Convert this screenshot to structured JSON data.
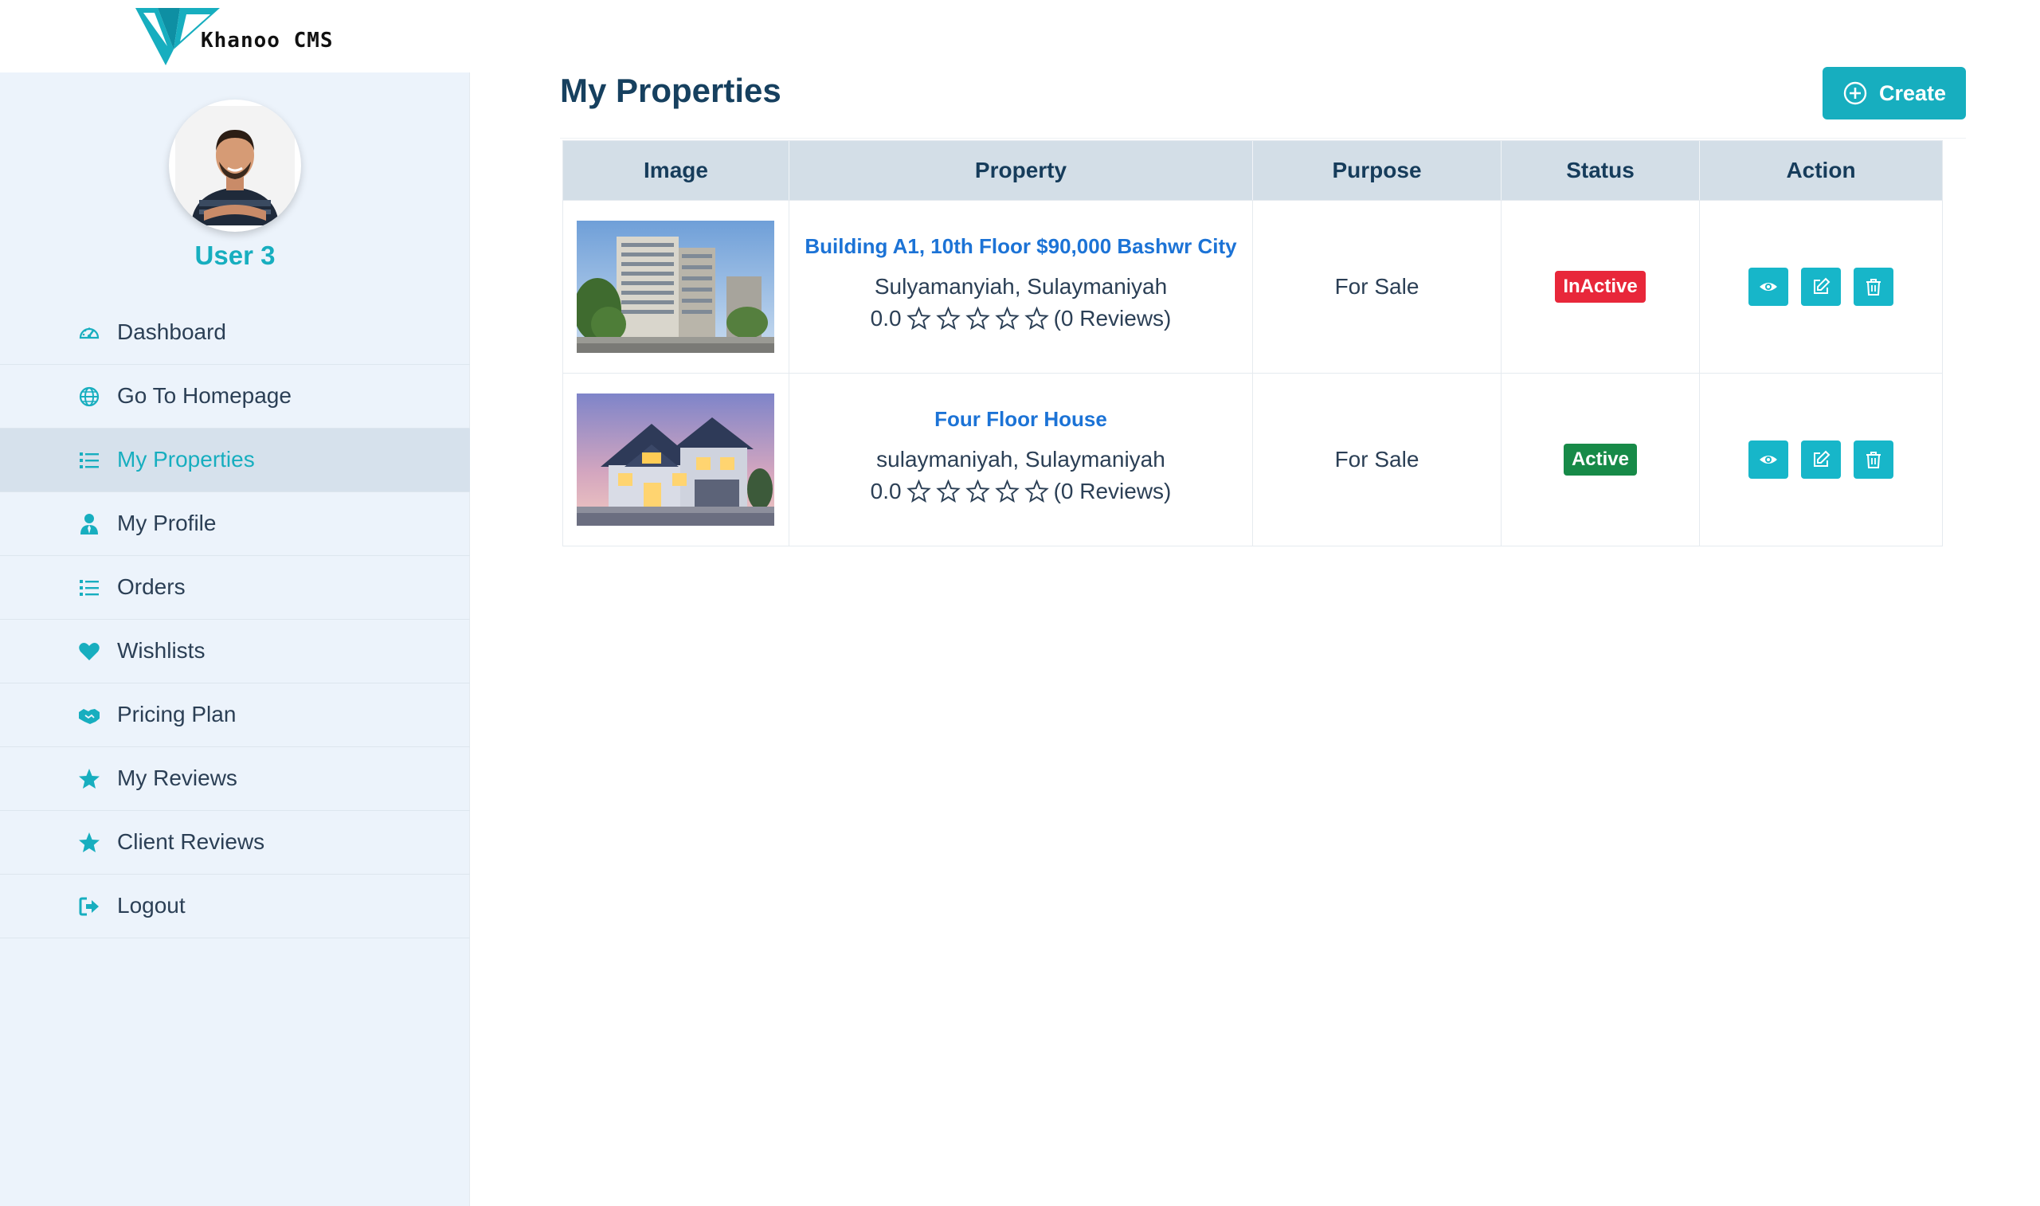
{
  "brand": {
    "name": "Khanoo CMS",
    "accent": "#17aebf"
  },
  "user": {
    "name": "User 3"
  },
  "sidebar": {
    "items": [
      {
        "label": "Dashboard",
        "icon": "dashboard-icon"
      },
      {
        "label": "Go To Homepage",
        "icon": "globe-icon"
      },
      {
        "label": "My Properties",
        "icon": "list-icon",
        "active": true
      },
      {
        "label": "My Profile",
        "icon": "user-icon"
      },
      {
        "label": "Orders",
        "icon": "list-icon"
      },
      {
        "label": "Wishlists",
        "icon": "heart-icon"
      },
      {
        "label": "Pricing Plan",
        "icon": "handshake-icon"
      },
      {
        "label": "My Reviews",
        "icon": "star-icon"
      },
      {
        "label": "Client Reviews",
        "icon": "star-icon"
      },
      {
        "label": "Logout",
        "icon": "logout-icon"
      }
    ]
  },
  "main": {
    "title": "My Properties",
    "create_label": "Create",
    "table": {
      "headers": [
        "Image",
        "Property",
        "Purpose",
        "Status",
        "Action"
      ],
      "rows": [
        {
          "title": "Building A1, 10th Floor $90,000 Bashwr City",
          "location": "Sulyamanyiah, Sulaymaniyah",
          "rating": "0.0",
          "reviews": "(0 Reviews)",
          "purpose": "For Sale",
          "status": "InActive",
          "status_color": "#e8273a"
        },
        {
          "title": "Four Floor House",
          "location": "sulaymaniyah, Sulaymaniyah",
          "rating": "0.0",
          "reviews": "(0 Reviews)",
          "purpose": "For Sale",
          "status": "Active",
          "status_color": "#178a48"
        }
      ]
    }
  }
}
